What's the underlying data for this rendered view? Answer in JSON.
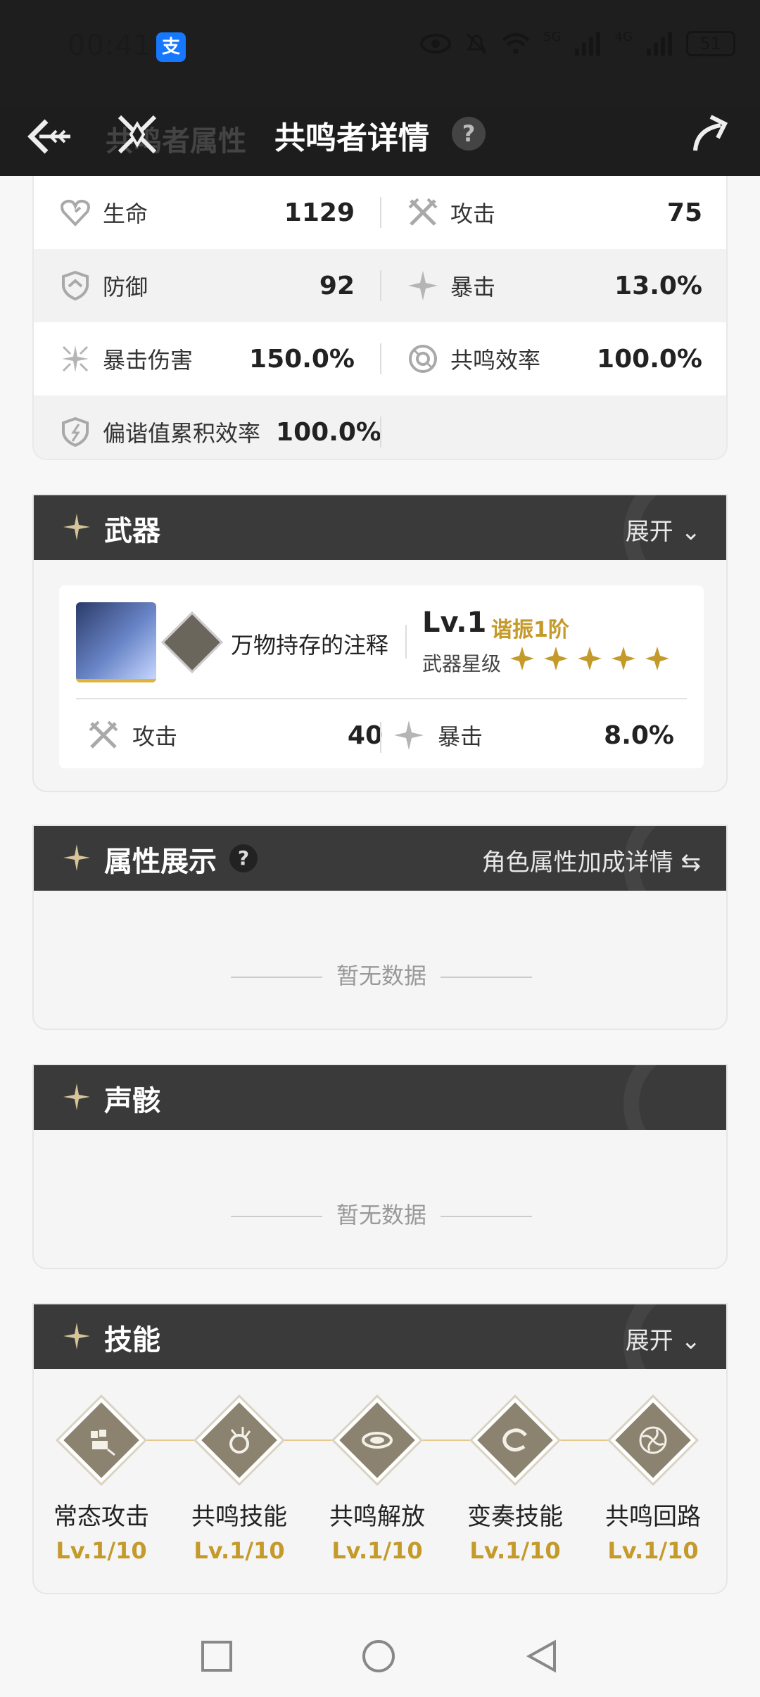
{
  "status_bar": {
    "time": "00:41",
    "alipay_icon": "支",
    "network1": "5G",
    "network2": "4G",
    "battery": "51"
  },
  "header": {
    "ghost_text": "共鸣者属性",
    "title": "共鸣者详情",
    "help": "?"
  },
  "stats": [
    {
      "left": {
        "icon": "heart-icon",
        "label": "生命",
        "value": "1129"
      },
      "right": {
        "icon": "swords-icon",
        "label": "攻击",
        "value": "75"
      }
    },
    {
      "left": {
        "icon": "shield-icon",
        "label": "防御",
        "value": "92"
      },
      "right": {
        "icon": "crit-icon",
        "label": "暴击",
        "value": "13.0%"
      }
    },
    {
      "left": {
        "icon": "crit-damage-icon",
        "label": "暴击伤害",
        "value": "150.0%"
      },
      "right": {
        "icon": "energy-icon",
        "label": "共鸣效率",
        "value": "100.0%"
      }
    },
    {
      "left": {
        "icon": "off-tune-icon",
        "label": "偏谐值累积效率",
        "value": "100.0%"
      },
      "right": null
    }
  ],
  "weapon_section": {
    "title": "武器",
    "expand": "展开",
    "weapon": {
      "name": "万物持存的注释",
      "level": "Lv.1",
      "tune": "谐振1阶",
      "star_label": "武器星级",
      "stars": 5,
      "stats": [
        {
          "icon": "swords-icon",
          "label": "攻击",
          "value": "40"
        },
        {
          "icon": "crit-icon",
          "label": "暴击",
          "value": "8.0%"
        }
      ]
    }
  },
  "attr_section": {
    "title": "属性展示",
    "help": "?",
    "link": "角色属性加成详情",
    "empty": "暂无数据"
  },
  "echo_section": {
    "title": "声骸",
    "empty": "暂无数据"
  },
  "skill_section": {
    "title": "技能",
    "expand": "展开",
    "skills": [
      {
        "name": "常态攻击",
        "level": "Lv.1/10"
      },
      {
        "name": "共鸣技能",
        "level": "Lv.1/10"
      },
      {
        "name": "共鸣解放",
        "level": "Lv.1/10"
      },
      {
        "name": "变奏技能",
        "level": "Lv.1/10"
      },
      {
        "name": "共鸣回路",
        "level": "Lv.1/10"
      }
    ]
  },
  "colors": {
    "gold": "#c49a2a",
    "header_bg": "#1d1d1d",
    "section_bg": "#3a3a3a"
  }
}
